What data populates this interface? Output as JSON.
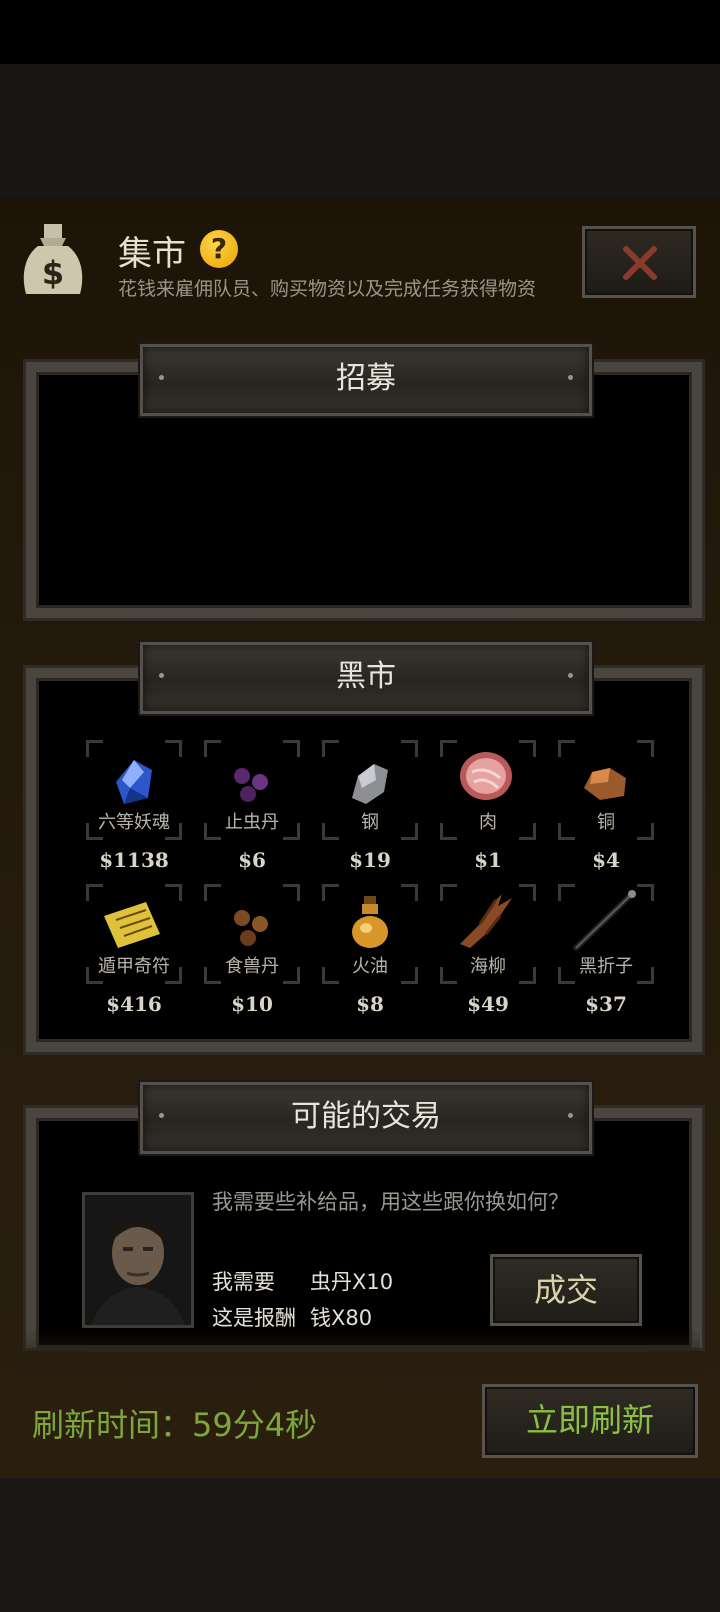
{
  "header": {
    "title": "集市",
    "help_icon": "?",
    "subtitle": "花钱来雇佣队员、购买物资以及完成任务获得物资"
  },
  "sections": {
    "recruit": "招募",
    "black_market": "黑市",
    "trades": "可能的交易"
  },
  "black_market_items": [
    {
      "name": "六等妖魂",
      "price": "$1138",
      "icon": "blue-crystal-icon"
    },
    {
      "name": "止虫丹",
      "price": "$6",
      "icon": "purple-pills-icon"
    },
    {
      "name": "钢",
      "price": "$19",
      "icon": "steel-ore-icon"
    },
    {
      "name": "肉",
      "price": "$1",
      "icon": "meat-icon"
    },
    {
      "name": "铜",
      "price": "$4",
      "icon": "copper-ore-icon"
    },
    {
      "name": "遁甲奇符",
      "price": "$416",
      "icon": "talisman-icon"
    },
    {
      "name": "食兽丹",
      "price": "$10",
      "icon": "brown-pills-icon"
    },
    {
      "name": "火油",
      "price": "$8",
      "icon": "oil-flask-icon"
    },
    {
      "name": "海柳",
      "price": "$49",
      "icon": "driftwood-icon"
    },
    {
      "name": "黑折子",
      "price": "$37",
      "icon": "black-stick-icon"
    }
  ],
  "trade": {
    "request_text": "我需要些补给品，用这些跟你换如何？",
    "need_label": "我需要",
    "need_item": "虫丹X10",
    "reward_label": "这是报酬",
    "reward_item": "钱X80",
    "deal_button": "成交"
  },
  "footer": {
    "refresh_time": "刷新时间：59分4秒",
    "refresh_button": "立即刷新"
  },
  "colors": {
    "refresh_green": "#7da63b",
    "help_yellow": "#ffc21a",
    "close_red": "#8a3a2c"
  }
}
